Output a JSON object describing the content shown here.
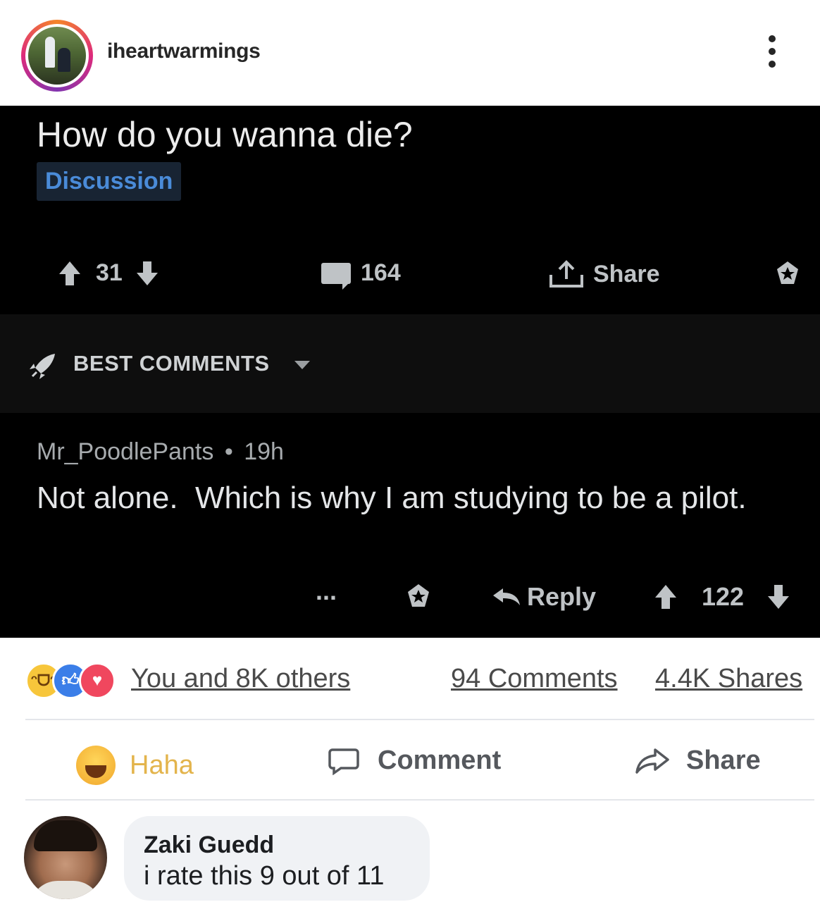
{
  "instagram": {
    "username": "iheartwarmings",
    "avatar_icon": "profile-photo",
    "more_icon": "vertical-ellipsis-icon"
  },
  "reddit": {
    "post_title": "How do you wanna die?",
    "flair": "Discussion",
    "votes": "31",
    "comment_count": "164",
    "share_label": "Share",
    "sort_label": "BEST COMMENTS",
    "comment": {
      "author": "Mr_PoodlePants",
      "separator": "•",
      "age": "19h",
      "body": "Not alone.  Which is why I am studying to be a pilot.",
      "more": "...",
      "reply_label": "Reply",
      "votes": "122"
    }
  },
  "facebook": {
    "reactions_text": "You and 8K others",
    "comments_text": "94 Comments",
    "shares_text": "4.4K Shares",
    "haha_label": "Haha",
    "comment_label": "Comment",
    "share_label": "Share",
    "commenter": "Zaki Guedd",
    "comment_text": "i rate this 9 out of 11",
    "colors": {
      "haha": "#e3b44c",
      "like": "#3b7ee8",
      "love": "#f0475e"
    }
  }
}
